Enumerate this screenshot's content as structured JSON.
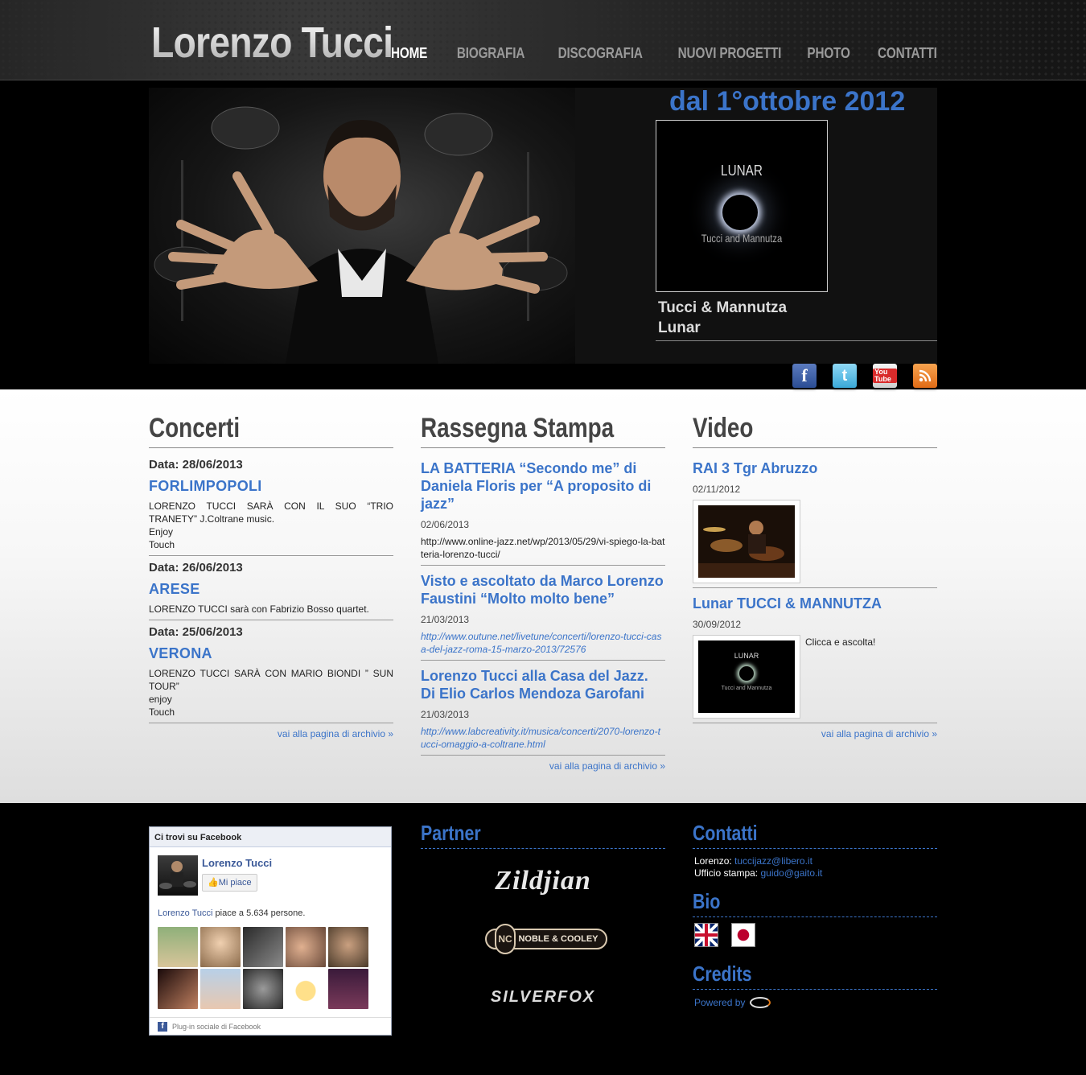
{
  "site": {
    "logo": "Lorenzo Tucci"
  },
  "nav": [
    {
      "label": "HOME",
      "active": true
    },
    {
      "label": "BIOGRAFIA"
    },
    {
      "label": "DISCOGRAFIA"
    },
    {
      "label": "NUOVI PROGETTI"
    },
    {
      "label": "PHOTO"
    },
    {
      "label": "CONTATTI"
    }
  ],
  "hero": {
    "promo_date": "dal 1°ottobre 2012",
    "album": {
      "title": "LUNAR",
      "artists": "Tucci and Mannutza"
    },
    "caption_line1": "Tucci & Mannutza",
    "caption_line2": "Lunar"
  },
  "social": [
    {
      "name": "facebook-icon",
      "glyph": "f"
    },
    {
      "name": "twitter-icon",
      "glyph": "t"
    },
    {
      "name": "youtube-icon",
      "glyph": "You Tube"
    },
    {
      "name": "rss-icon",
      "glyph": "rss"
    }
  ],
  "concerti": {
    "heading": "Concerti",
    "items": [
      {
        "date": "Data: 28/06/2013",
        "city": "FORLIMPOPOLI",
        "lines": [
          "LORENZO TUCCI SARÀ CON IL SUO “TRIO TRANETY” J.Coltrane music.",
          "Enjoy",
          "Touch"
        ]
      },
      {
        "date": "Data: 26/06/2013",
        "city": "ARESE",
        "lines": [
          "LORENZO TUCCI sarà con Fabrizio Bosso quartet."
        ]
      },
      {
        "date": "Data: 25/06/2013",
        "city": "VERONA",
        "lines": [
          "LORENZO TUCCI SARÀ CON MARIO BIONDI ” SUN TOUR”",
          "enjoy",
          "Touch"
        ]
      }
    ],
    "archive": "vai alla pagina di archivio »"
  },
  "rassegna": {
    "heading": "Rassegna Stampa",
    "items": [
      {
        "title": "LA BATTERIA “Secondo me” di Daniela Floris per “A proposito di jazz”",
        "date": "02/06/2013",
        "link": "http://www.online-jazz.net/wp/2013/05/29/vi-spiego-la-batteria-lorenzo-tucci/"
      },
      {
        "title": "Visto e ascoltato da Marco Lorenzo Faustini “Molto molto bene”",
        "date": "21/03/2013",
        "link": "http://www.outune.net/livetune/concerti/lorenzo-tucci-casa-del-jazz-roma-15-marzo-2013/72576"
      },
      {
        "title": "Lorenzo Tucci alla Casa del Jazz. Di Elio Carlos Mendoza Garofani",
        "date": "21/03/2013",
        "link": "http://www.labcreativity.it/musica/concerti/2070-lorenzo-tucci-omaggio-a-coltrane.html"
      }
    ],
    "archive": "vai alla pagina di archivio »"
  },
  "video": {
    "heading": "Video",
    "items": [
      {
        "title": "RAI 3 Tgr Abruzzo",
        "date": "02/11/2012",
        "note": ""
      },
      {
        "title": "Lunar TUCCI & MANNUTZA",
        "date": "30/09/2012",
        "note": "Clicca e ascolta!",
        "thumb_title": "LUNAR",
        "thumb_sub": "Tucci and Mannutza"
      }
    ],
    "archive": "vai alla pagina di archivio »"
  },
  "facebook": {
    "header": "Ci trovi su Facebook",
    "page_name": "Lorenzo Tucci",
    "like": "Mi piace",
    "count_name": "Lorenzo Tucci",
    "count_text": " piace a 5.634 persone.",
    "plugin": "Plug-in sociale di Facebook"
  },
  "partner": {
    "heading": "Partner",
    "logos": [
      "Zildjian",
      "NOBLE & COOLEY",
      "SILVERFOX"
    ]
  },
  "contatti": {
    "heading": "Contatti",
    "lorenzo_label": "Lorenzo: ",
    "lorenzo_email": "tuccijazz@libero.it",
    "ufficio_label": "Ufficio stampa: ",
    "ufficio_email": "guido@gaito.it"
  },
  "bio": {
    "heading": "Bio"
  },
  "credits": {
    "heading": "Credits",
    "powered": "Powered by"
  },
  "colors": {
    "accent": "#3b74c9",
    "facebook": "#3b5998"
  }
}
